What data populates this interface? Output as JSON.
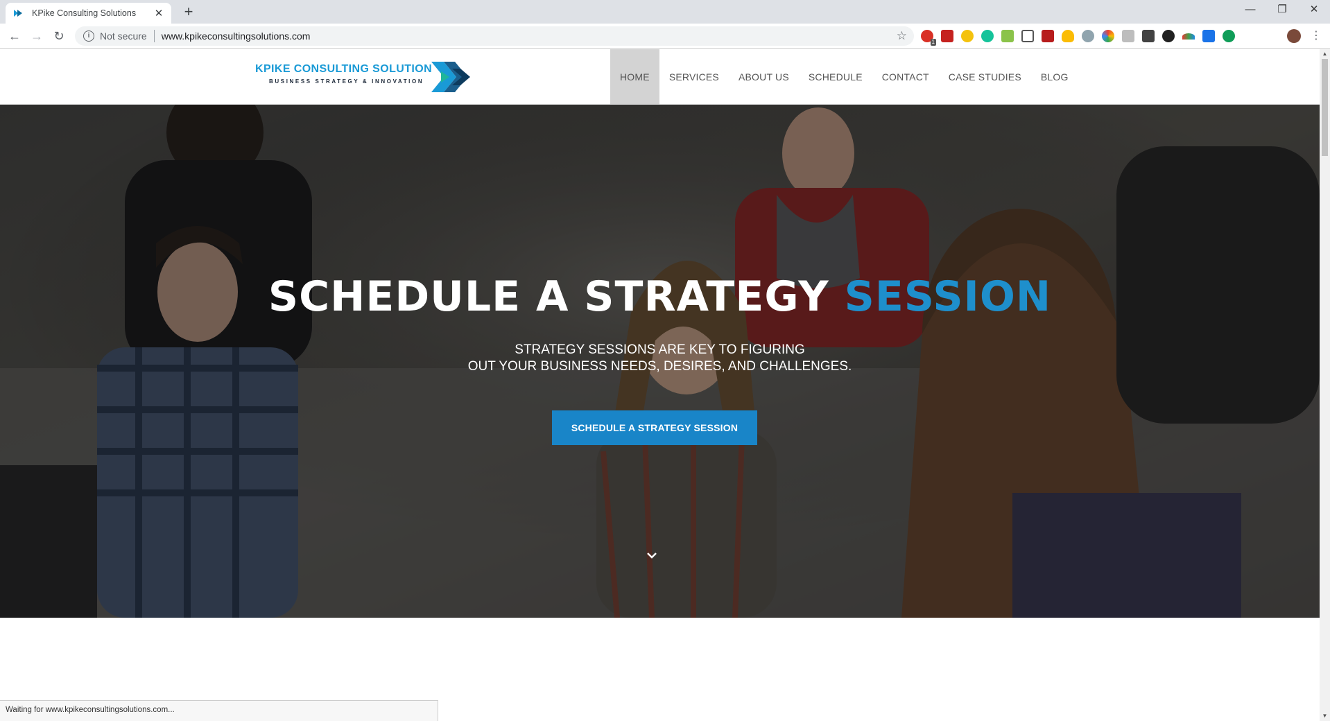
{
  "browser": {
    "tab_title": "KPike Consulting Solutions",
    "tab_close": "✕",
    "new_tab": "+",
    "security_label": "Not secure",
    "url": "www.kpikeconsultingsolutions.com",
    "extension_badge": "1",
    "window_controls": [
      "—",
      "❐",
      "✕"
    ]
  },
  "site": {
    "logo_name": "KPIKE CONSULTING SOLUTION",
    "logo_tagline": "BUSINESS STRATEGY & INNOVATION",
    "nav": [
      "HOME",
      "SERVICES",
      "ABOUT US",
      "SCHEDULE",
      "CONTACT",
      "CASE STUDIES",
      "BLOG"
    ],
    "active_nav": "HOME",
    "accent_color": "#1e8fcc"
  },
  "hero": {
    "title_main": "SCHEDULE A STRATEGY ",
    "title_accent": "SESSION",
    "subtitle_line1": "STRATEGY SESSIONS ARE KEY TO FIGURING",
    "subtitle_line2": "OUT YOUR BUSINESS NEEDS, DESIRES, AND CHALLENGES.",
    "cta_label": "SCHEDULE A STRATEGY SESSION",
    "scroll_icon": "chevron-down-icon"
  },
  "status_bar": {
    "text": "Waiting for www.kpikeconsultingsolutions.com..."
  }
}
